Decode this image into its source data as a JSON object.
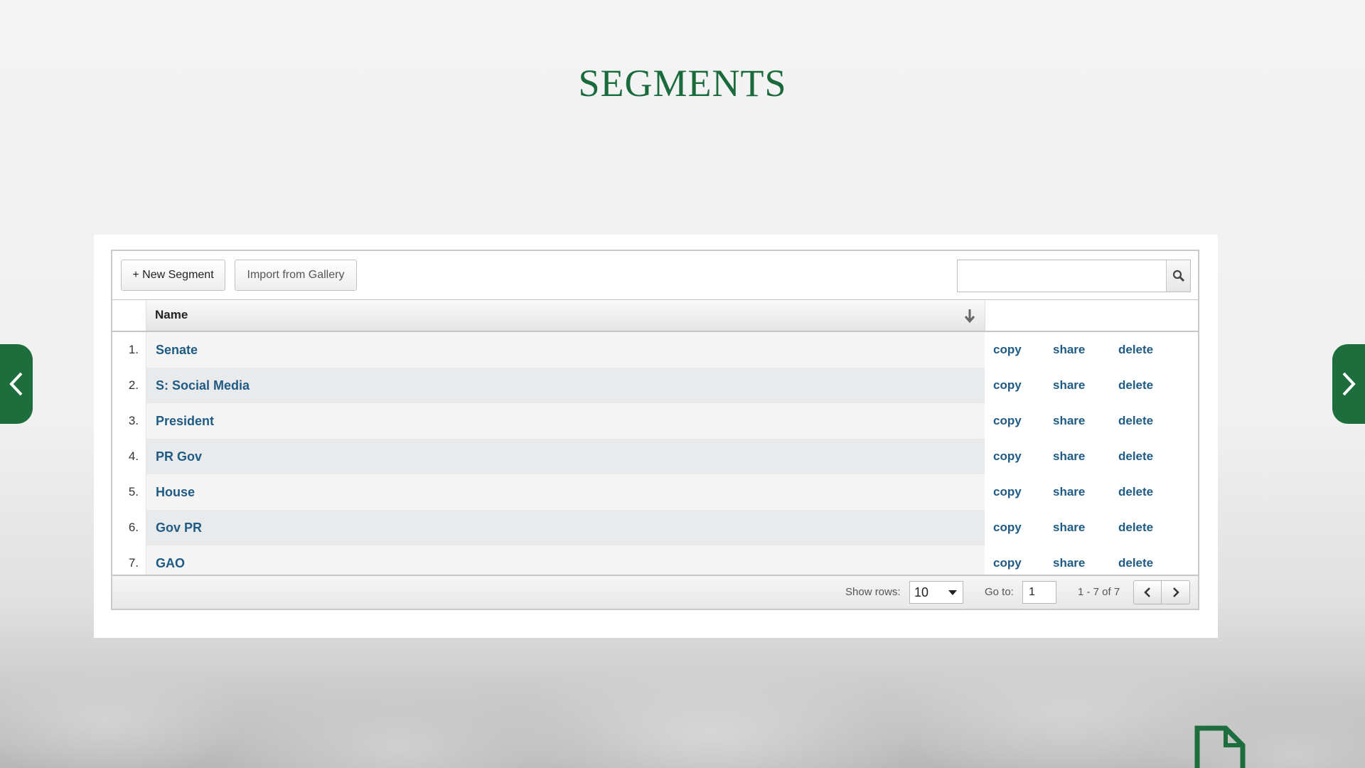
{
  "slide": {
    "title": "SEGMENTS"
  },
  "toolbar": {
    "new_segment_label": "+ New Segment",
    "import_label": "Import from Gallery",
    "search_value": "",
    "search_icon": "magnifier-icon"
  },
  "table": {
    "columns": {
      "number": "",
      "name": "Name",
      "actions": ""
    },
    "sort_icon": "sort-down-arrow-icon",
    "rows": [
      {
        "num": "1.",
        "name": "Senate",
        "copy": "copy",
        "share": "share",
        "delete": "delete"
      },
      {
        "num": "2.",
        "name": "S: Social Media",
        "copy": "copy",
        "share": "share",
        "delete": "delete"
      },
      {
        "num": "3.",
        "name": "President",
        "copy": "copy",
        "share": "share",
        "delete": "delete"
      },
      {
        "num": "4.",
        "name": "PR Gov",
        "copy": "copy",
        "share": "share",
        "delete": "delete"
      },
      {
        "num": "5.",
        "name": "House",
        "copy": "copy",
        "share": "share",
        "delete": "delete"
      },
      {
        "num": "6.",
        "name": "Gov PR",
        "copy": "copy",
        "share": "share",
        "delete": "delete"
      },
      {
        "num": "7.",
        "name": "GAO",
        "copy": "copy",
        "share": "share",
        "delete": "delete"
      }
    ]
  },
  "footer": {
    "show_rows_label": "Show rows:",
    "show_rows_value": "10",
    "goto_label": "Go to:",
    "goto_value": "1",
    "range_text": "1 - 7 of 7"
  },
  "colors": {
    "brand_green": "#1d6e3c",
    "link_blue": "#1f5b85"
  }
}
